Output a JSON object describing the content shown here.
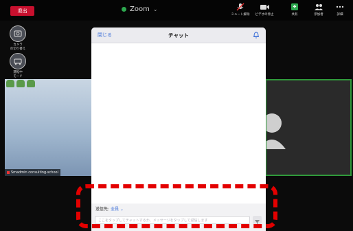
{
  "topbar": {
    "leave_label": "退出",
    "title": "Zoom",
    "buttons": [
      {
        "label": "ミュート解除",
        "icon": "microphone-muted-icon"
      },
      {
        "label": "ビデオの停止",
        "icon": "video-camera-icon"
      },
      {
        "label": "共有",
        "icon": "share-screen-icon"
      },
      {
        "label": "参加者",
        "icon": "participants-icon"
      },
      {
        "label": "詳細",
        "icon": "more-icon"
      }
    ]
  },
  "side": {
    "switch_camera_label": "カメラ\nの切り替え",
    "drive_mode_label": "運転中\nモード"
  },
  "video": {
    "participant_name": "Smadmin consulting-school"
  },
  "chat": {
    "close_label": "閉じる",
    "title": "チャット",
    "to_label": "送信先:",
    "recipient": "全員",
    "input_placeholder": "ここをタップしてチャットするか、メッセージをタップして返信します"
  },
  "colors": {
    "leave": "#c8102e",
    "accent_blue": "#3c6fd8",
    "highlight_red": "#e30000",
    "speaker_green": "#2f9a3a",
    "share_green": "#2da84f"
  }
}
